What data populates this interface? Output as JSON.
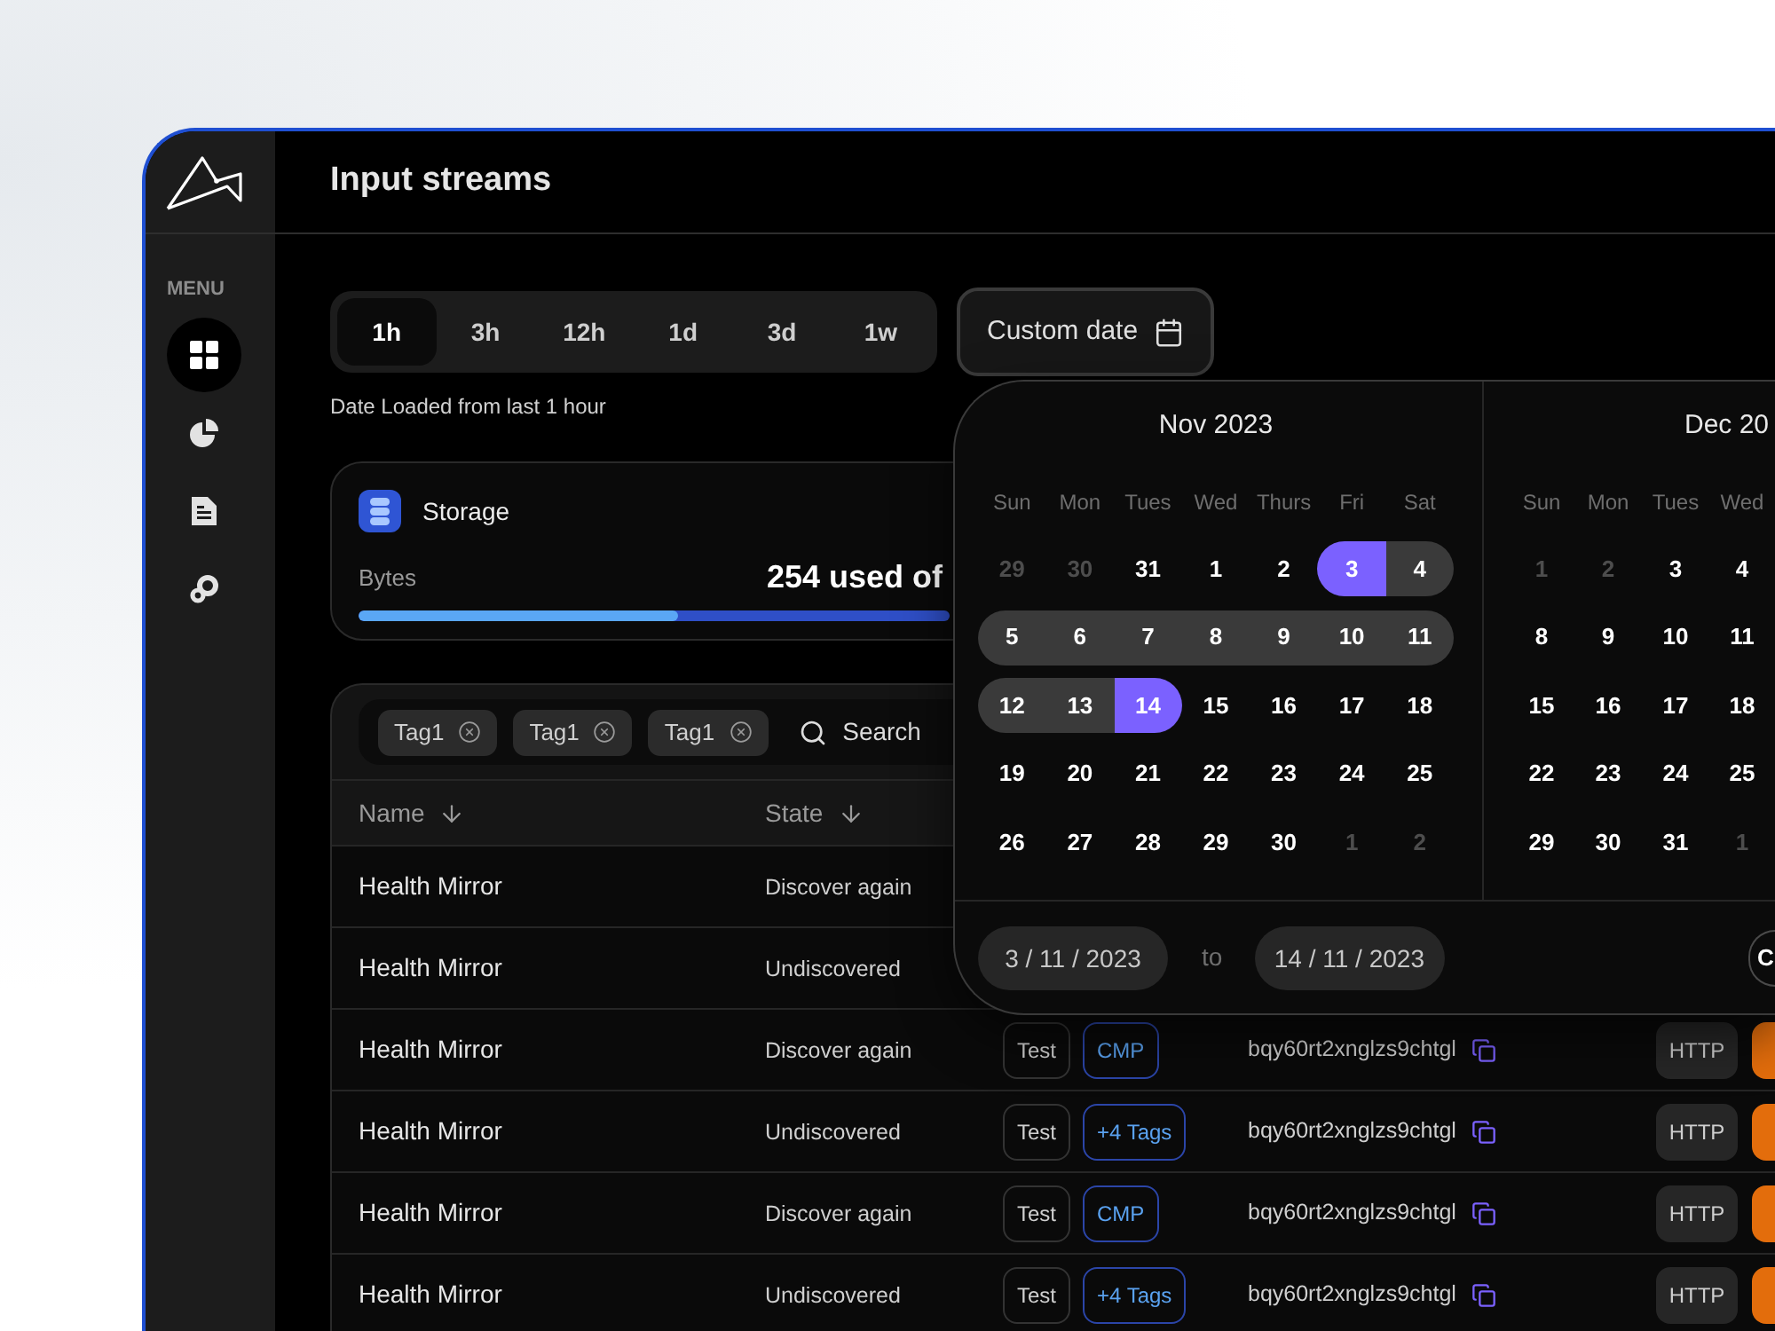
{
  "sidebar": {
    "menu_label": "MENU",
    "items": [
      {
        "kind": "dashboard",
        "selected": true
      },
      {
        "kind": "charts",
        "selected": false
      },
      {
        "kind": "documents",
        "selected": false
      },
      {
        "kind": "integrations",
        "selected": false
      }
    ]
  },
  "header": {
    "title": "Input streams"
  },
  "time_ranges": [
    {
      "label": "1h",
      "selected": true
    },
    {
      "label": "3h",
      "selected": false
    },
    {
      "label": "12h",
      "selected": false
    },
    {
      "label": "1d",
      "selected": false
    },
    {
      "label": "3d",
      "selected": false
    },
    {
      "label": "1w",
      "selected": false
    }
  ],
  "custom_date": {
    "label": "Custom date"
  },
  "range_caption": "Date Loaded from last 1 hour",
  "storage": {
    "title": "Storage",
    "metric": "Bytes",
    "usage": "254 used of",
    "level": 0.54
  },
  "filters": {
    "tags": [
      {
        "label": "Tag1"
      },
      {
        "label": "Tag1"
      },
      {
        "label": "Tag1"
      }
    ],
    "search": {
      "placeholder": "Search"
    }
  },
  "table": {
    "columns": [
      {
        "label": "Name"
      },
      {
        "label": "State"
      }
    ],
    "rows": [
      {
        "name": "Health Mirror",
        "state": "Discover again"
      },
      {
        "name": "Health Mirror",
        "state": "Undiscovered"
      },
      {
        "name": "Health Mirror",
        "state": "Discover again",
        "tags": [
          {
            "label": "Test",
            "kind": "plain"
          },
          {
            "label": "CMP",
            "kind": "accent"
          }
        ],
        "id": "bqy60rt2xnglzs9chtgl",
        "protocol": "HTTP",
        "method_badge": true
      },
      {
        "name": "Health Mirror",
        "state": "Undiscovered",
        "tags": [
          {
            "label": "Test",
            "kind": "plain"
          },
          {
            "label": "+4 Tags",
            "kind": "accent"
          }
        ],
        "id": "bqy60rt2xnglzs9chtgl",
        "protocol": "HTTP",
        "method_badge": true
      },
      {
        "name": "Health Mirror",
        "state": "Discover again",
        "tags": [
          {
            "label": "Test",
            "kind": "plain"
          },
          {
            "label": "CMP",
            "kind": "accent"
          }
        ],
        "id": "bqy60rt2xnglzs9chtgl",
        "protocol": "HTTP",
        "method_badge": true
      },
      {
        "name": "Health Mirror",
        "state": "Undiscovered",
        "tags": [
          {
            "label": "Test",
            "kind": "plain"
          },
          {
            "label": "+4 Tags",
            "kind": "accent"
          }
        ],
        "id": "bqy60rt2xnglzs9chtgl",
        "protocol": "HTTP",
        "method_badge": true
      }
    ]
  },
  "calendar": {
    "months": [
      {
        "title": "Nov 2023",
        "weekdays": [
          "Sun",
          "Mon",
          "Tues",
          "Wed",
          "Thurs",
          "Fri",
          "Sat"
        ],
        "weeks": [
          [
            {
              "label": "29",
              "muted": true,
              "in_range": false,
              "selected": false
            },
            {
              "label": "30",
              "muted": true,
              "in_range": false,
              "selected": false
            },
            {
              "label": "31",
              "muted": false,
              "in_range": false,
              "selected": false
            },
            {
              "label": "1",
              "muted": false,
              "in_range": false,
              "selected": false
            },
            {
              "label": "2",
              "muted": false,
              "in_range": false,
              "selected": false
            },
            {
              "label": "3",
              "muted": false,
              "in_range": true,
              "selected": true
            },
            {
              "label": "4",
              "muted": false,
              "in_range": true,
              "selected": false
            }
          ],
          [
            {
              "label": "5",
              "muted": false,
              "in_range": true,
              "selected": false
            },
            {
              "label": "6",
              "muted": false,
              "in_range": true,
              "selected": false
            },
            {
              "label": "7",
              "muted": false,
              "in_range": true,
              "selected": false
            },
            {
              "label": "8",
              "muted": false,
              "in_range": true,
              "selected": false
            },
            {
              "label": "9",
              "muted": false,
              "in_range": true,
              "selected": false
            },
            {
              "label": "10",
              "muted": false,
              "in_range": true,
              "selected": false
            },
            {
              "label": "11",
              "muted": false,
              "in_range": true,
              "selected": false
            }
          ],
          [
            {
              "label": "12",
              "muted": false,
              "in_range": true,
              "selected": false
            },
            {
              "label": "13",
              "muted": false,
              "in_range": true,
              "selected": false
            },
            {
              "label": "14",
              "muted": false,
              "in_range": true,
              "selected": true
            },
            {
              "label": "15",
              "muted": false,
              "in_range": false,
              "selected": false
            },
            {
              "label": "16",
              "muted": false,
              "in_range": false,
              "selected": false
            },
            {
              "label": "17",
              "muted": false,
              "in_range": false,
              "selected": false
            },
            {
              "label": "18",
              "muted": false,
              "in_range": false,
              "selected": false
            }
          ],
          [
            {
              "label": "19",
              "muted": false,
              "in_range": false,
              "selected": false
            },
            {
              "label": "20",
              "muted": false,
              "in_range": false,
              "selected": false
            },
            {
              "label": "21",
              "muted": false,
              "in_range": false,
              "selected": false
            },
            {
              "label": "22",
              "muted": false,
              "in_range": false,
              "selected": false
            },
            {
              "label": "23",
              "muted": false,
              "in_range": false,
              "selected": false
            },
            {
              "label": "24",
              "muted": false,
              "in_range": false,
              "selected": false
            },
            {
              "label": "25",
              "muted": false,
              "in_range": false,
              "selected": false
            }
          ],
          [
            {
              "label": "26",
              "muted": false,
              "in_range": false,
              "selected": false
            },
            {
              "label": "27",
              "muted": false,
              "in_range": false,
              "selected": false
            },
            {
              "label": "28",
              "muted": false,
              "in_range": false,
              "selected": false
            },
            {
              "label": "29",
              "muted": false,
              "in_range": false,
              "selected": false
            },
            {
              "label": "30",
              "muted": false,
              "in_range": false,
              "selected": false
            },
            {
              "label": "1",
              "muted": true,
              "in_range": false,
              "selected": false
            },
            {
              "label": "2",
              "muted": true,
              "in_range": false,
              "selected": false
            }
          ]
        ]
      },
      {
        "title": "Dec 20",
        "weekdays": [
          "Sun",
          "Mon",
          "Tues",
          "Wed"
        ],
        "weeks": [
          [
            {
              "label": "1",
              "muted": true,
              "in_range": false,
              "selected": false
            },
            {
              "label": "2",
              "muted": true,
              "in_range": false,
              "selected": false
            },
            {
              "label": "3",
              "muted": false,
              "in_range": false,
              "selected": false
            },
            {
              "label": "4",
              "muted": false,
              "in_range": false,
              "selected": false
            }
          ],
          [
            {
              "label": "8",
              "muted": false,
              "in_range": false,
              "selected": false
            },
            {
              "label": "9",
              "muted": false,
              "in_range": false,
              "selected": false
            },
            {
              "label": "10",
              "muted": false,
              "in_range": false,
              "selected": false
            },
            {
              "label": "11",
              "muted": false,
              "in_range": false,
              "selected": false
            }
          ],
          [
            {
              "label": "15",
              "muted": false,
              "in_range": false,
              "selected": false
            },
            {
              "label": "16",
              "muted": false,
              "in_range": false,
              "selected": false
            },
            {
              "label": "17",
              "muted": false,
              "in_range": false,
              "selected": false
            },
            {
              "label": "18",
              "muted": false,
              "in_range": false,
              "selected": false
            }
          ],
          [
            {
              "label": "22",
              "muted": false,
              "in_range": false,
              "selected": false
            },
            {
              "label": "23",
              "muted": false,
              "in_range": false,
              "selected": false
            },
            {
              "label": "24",
              "muted": false,
              "in_range": false,
              "selected": false
            },
            {
              "label": "25",
              "muted": false,
              "in_range": false,
              "selected": false
            }
          ],
          [
            {
              "label": "29",
              "muted": false,
              "in_range": false,
              "selected": false
            },
            {
              "label": "30",
              "muted": false,
              "in_range": false,
              "selected": false
            },
            {
              "label": "31",
              "muted": false,
              "in_range": false,
              "selected": false
            },
            {
              "label": "1",
              "muted": true,
              "in_range": false,
              "selected": false
            }
          ]
        ]
      }
    ],
    "start_date": {
      "value": "3 / 11 / 2023"
    },
    "separator": "to",
    "end_date": {
      "value": "14 / 11 / 2023"
    },
    "action": "C"
  }
}
